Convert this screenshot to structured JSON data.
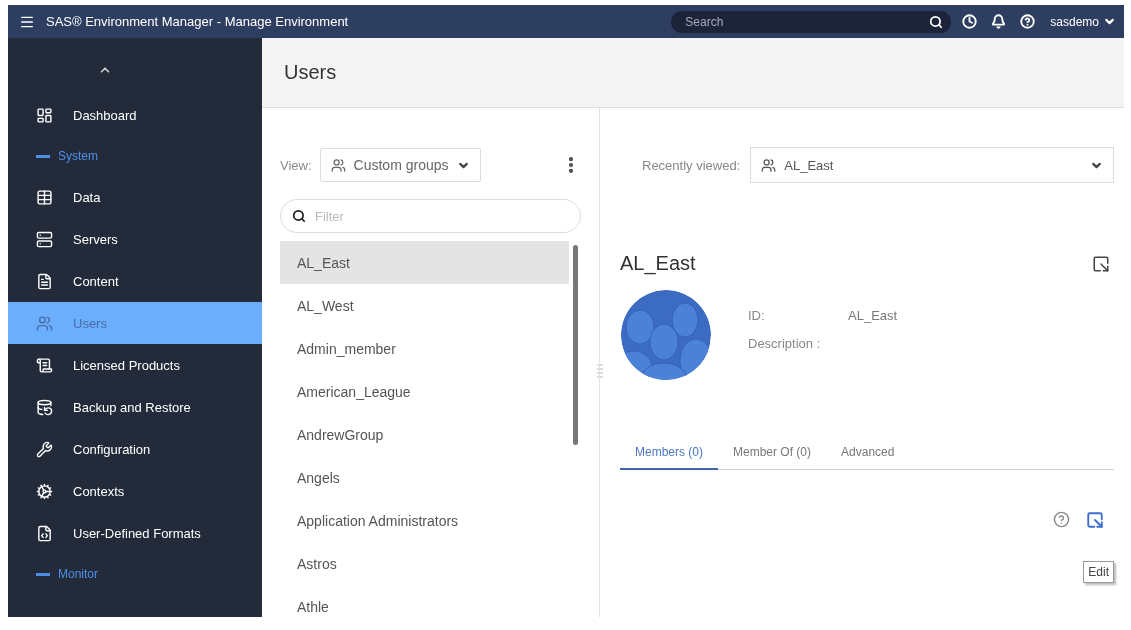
{
  "app": {
    "title": "SAS® Environment Manager - Manage Environment",
    "search": {
      "placeholder": "Search"
    },
    "user": "sasdemo"
  },
  "sidebar": {
    "items": [
      {
        "kind": "item",
        "label": "Dashboard",
        "selected": false
      },
      {
        "kind": "section",
        "label": "System"
      },
      {
        "kind": "item",
        "label": "Data",
        "selected": false
      },
      {
        "kind": "item",
        "label": "Servers",
        "selected": false
      },
      {
        "kind": "item",
        "label": "Content",
        "selected": false
      },
      {
        "kind": "item",
        "label": "Users",
        "selected": true
      },
      {
        "kind": "item",
        "label": "Licensed Products",
        "selected": false
      },
      {
        "kind": "item",
        "label": "Backup and Restore",
        "selected": false
      },
      {
        "kind": "item",
        "label": "Configuration",
        "selected": false
      },
      {
        "kind": "item",
        "label": "Contexts",
        "selected": false
      },
      {
        "kind": "item",
        "label": "User-Defined Formats",
        "selected": false
      },
      {
        "kind": "section",
        "label": "Monitor"
      }
    ]
  },
  "page_title": "Users",
  "list_panel": {
    "view_label": "View:",
    "view_value": "Custom groups",
    "filter": {
      "placeholder": "Filter"
    },
    "groups": [
      {
        "label": "AL_East",
        "selected": true
      },
      {
        "label": "AL_West",
        "selected": false
      },
      {
        "label": "Admin_member",
        "selected": false
      },
      {
        "label": "American_League",
        "selected": false
      },
      {
        "label": "AndrewGroup",
        "selected": false
      },
      {
        "label": "Angels",
        "selected": false
      },
      {
        "label": "Application Administrators",
        "selected": false
      },
      {
        "label": "Astros",
        "selected": false
      },
      {
        "label": "Athle",
        "selected": false
      }
    ]
  },
  "detail": {
    "recent_label": "Recently viewed:",
    "recent_value": "AL_East",
    "name": "AL_East",
    "fields": [
      {
        "label": "ID:",
        "value": "AL_East"
      },
      {
        "label": "Description :"
      }
    ],
    "tabs": [
      {
        "label": "Members (0)",
        "selected": true
      },
      {
        "label": "Member Of (0)",
        "selected": false
      },
      {
        "label": "Advanced",
        "selected": false
      }
    ],
    "tooltip": "Edit"
  }
}
